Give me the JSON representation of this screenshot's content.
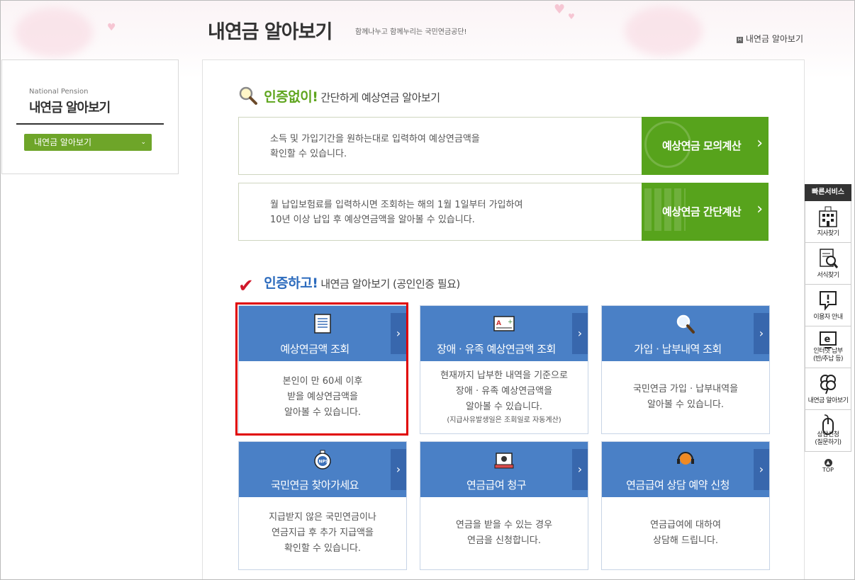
{
  "header": {
    "title": "내연금 알아보기",
    "slogan": "함께나누고 함께누리는 국민연금공단!",
    "breadcrumb": "내연금 알아보기"
  },
  "sidebar": {
    "eyebrow": "National Pension",
    "title": "내연금 알아보기",
    "selected": "내연금 알아보기"
  },
  "section1": {
    "highlight": "인증없이!",
    "rest": "간단하게 예상연금 알아보기",
    "rows": [
      {
        "line1": "소득 및 가입기간을 원하는대로 입력하여 예상연금액을",
        "line2": "확인할 수 있습니다.",
        "button": "예상연금 모의계산"
      },
      {
        "line1": "월 납입보험료를 입력하시면 조회하는 해의 1월 1일부터 가입하여",
        "line2": "10년 이상 납입 후 예상연금액을 알아볼 수 있습니다.",
        "button": "예상연금 간단계산"
      }
    ]
  },
  "section2": {
    "highlight": "인증하고!",
    "rest": "내연금 알아보기 (공인인증 필요)"
  },
  "cards": [
    {
      "title": "예상연금액 조회",
      "lines": [
        "본인이 만 60세 이후",
        "받을 예상연금액을",
        "알아볼 수 있습니다."
      ],
      "note": ""
    },
    {
      "title": "장애 · 유족 예상연금액 조회",
      "lines": [
        "현재까지 납부한 내역을 기준으로",
        "장애 · 유족 예상연금액을",
        "알아볼 수 있습니다."
      ],
      "note": "(지급사유발생일은 조회일로 자동계산)"
    },
    {
      "title": "가입 · 납부내역 조회",
      "lines": [
        "국민연금 가입 · 납부내역을",
        "알아볼 수 있습니다."
      ],
      "note": ""
    },
    {
      "title": "국민연금 찾아가세요",
      "lines": [
        "지급받지 않은 국민연금이나",
        "연금지급 후 추가 지급액을",
        "확인할 수 있습니다."
      ],
      "note": ""
    },
    {
      "title": "연금급여 청구",
      "lines": [
        "연금을 받을 수 있는 경우",
        "연금을 신청합니다."
      ],
      "note": ""
    },
    {
      "title": "연금급여 상담 예약 신청",
      "lines": [
        "연금급여에 대하여",
        "상담해 드립니다."
      ],
      "note": ""
    }
  ],
  "quick": {
    "title": "빠른서비스",
    "items": [
      {
        "label": "지사찾기",
        "icon": "building-icon"
      },
      {
        "label": "서식찾기",
        "icon": "document-search-icon"
      },
      {
        "label": "이용자 안내",
        "icon": "speech-exclamation-icon"
      },
      {
        "label": "인터넷 납부\n(반/추납 등)",
        "icon": "e-monitor-icon"
      },
      {
        "label": "내연금 알아보기",
        "icon": "clover-icon"
      },
      {
        "label": "상담신청\n(질문하기)",
        "icon": "mouse-icon"
      }
    ],
    "top": "TOP"
  },
  "colors": {
    "green": "#57a31c",
    "blue": "#4a80c6",
    "highlight": "#e00000"
  }
}
